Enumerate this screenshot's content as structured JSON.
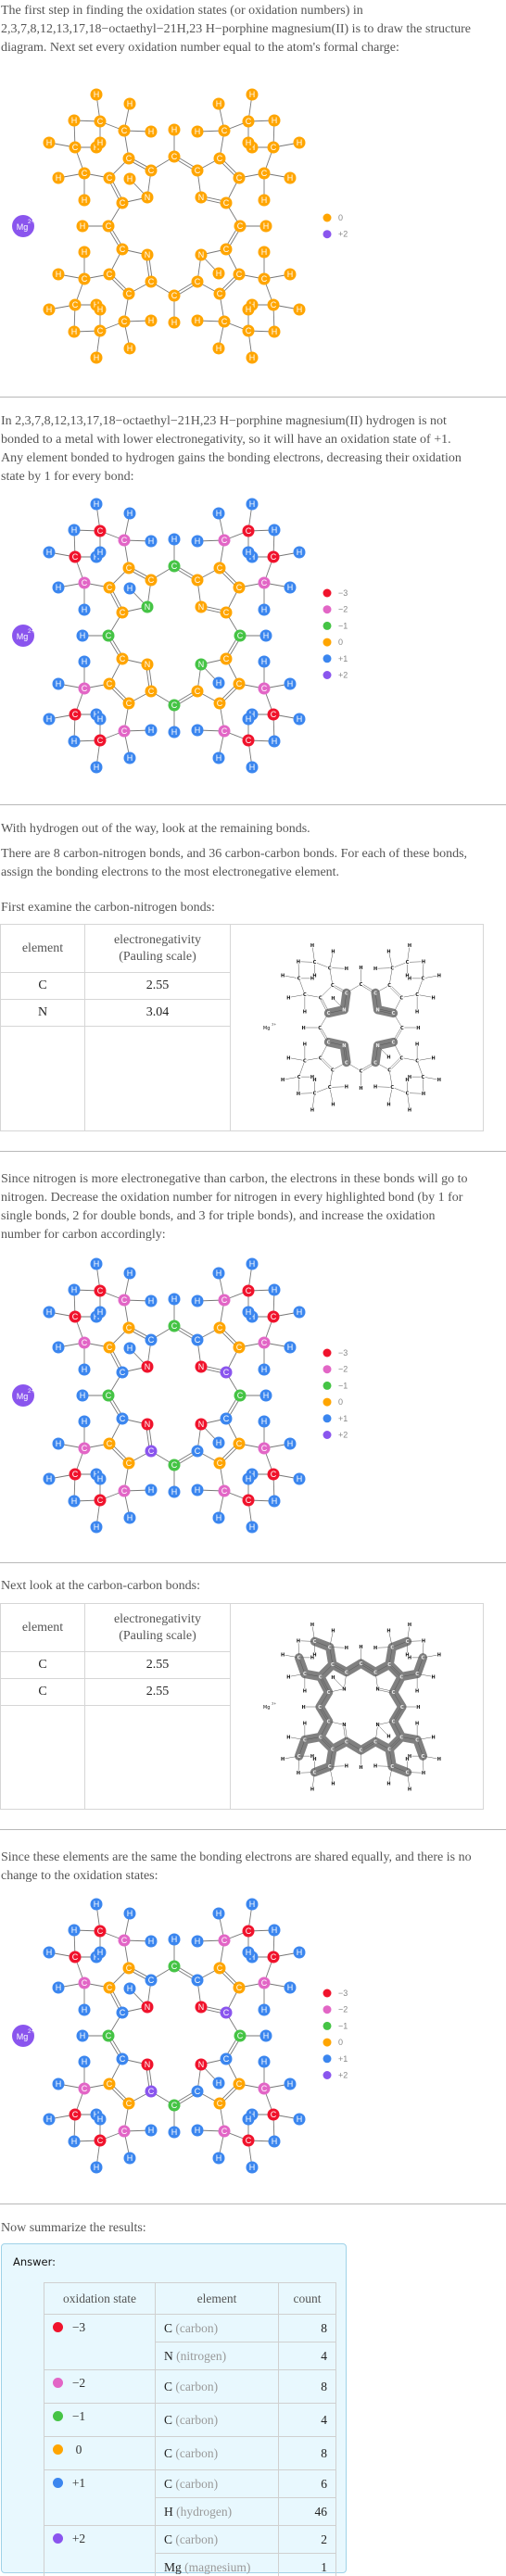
{
  "paragraphs": {
    "intro": "The first step in finding the oxidation states (or oxidation numbers) in 2,3,7,8,12,13,17,18−octaethyl−21H,23 H−porphine magnesium(II) is to draw the structure diagram. Next set every oxidation number equal to the atom's formal charge:",
    "hydrogen": "In 2,3,7,8,12,13,17,18−octaethyl−21H,23 H−porphine magnesium(II) hydrogen is not bonded to a metal with lower electronegativity, so it will have an oxidation state of +1. Any element bonded to hydrogen gains the bonding electrons, decreasing their oxidation state by 1 for every bond:",
    "remaining": "With hydrogen out of the way, look at the remaining bonds.",
    "bond_counts": "There are 8 carbon-nitrogen bonds, and 36 carbon-carbon bonds.  For each of these bonds, assign the bonding electrons to the most electronegative element.",
    "first_cn": "First examine the carbon-nitrogen bonds:",
    "nitrogen": "Since nitrogen is more electronegative than carbon, the electrons in these bonds will go to nitrogen. Decrease the oxidation number for nitrogen in every highlighted bond (by 1 for single bonds, 2 for double bonds, and 3 for triple bonds), and increase the oxidation number for carbon accordingly:",
    "next_cc": "Next look at the carbon-carbon bonds:",
    "same": "Since these elements are the same the bonding electrons are shared equally, and there is no change to the oxidation states:",
    "summarize": "Now summarize the results:"
  },
  "atom_labels": {
    "C": "C",
    "H": "H",
    "N": "N",
    "Mg": "Mg",
    "Mg_charge": "2+"
  },
  "colors": {
    "-3": "#f0132c",
    "-2": "#e266c6",
    "-1": "#45c445",
    "0": "#ffa500",
    "+1": "#3b86ef",
    "+2": "#8a55ee",
    "highlight": "#808080"
  },
  "legend_initial": [
    {
      "label": "0",
      "color": "#ffa500"
    },
    {
      "label": "+2",
      "color": "#8a55ee"
    }
  ],
  "legend_full": [
    {
      "label": "−3",
      "color": "#f0132c"
    },
    {
      "label": "−2",
      "color": "#e266c6"
    },
    {
      "label": "−1",
      "color": "#45c445"
    },
    {
      "label": "0",
      "color": "#ffa500"
    },
    {
      "label": "+1",
      "color": "#3b86ef"
    },
    {
      "label": "+2",
      "color": "#8a55ee"
    }
  ],
  "table_cn": {
    "header_element": "element",
    "header_en_1": "electronegativity",
    "header_en_2": "(Pauling scale)",
    "rows": [
      {
        "element": "C",
        "value": "2.55"
      },
      {
        "element": "N",
        "value": "3.04"
      }
    ]
  },
  "table_cc": {
    "header_element": "element",
    "header_en_1": "electronegativity",
    "header_en_2": "(Pauling scale)",
    "rows": [
      {
        "element": "C",
        "value": "2.55"
      },
      {
        "element": "C",
        "value": "2.55"
      }
    ]
  },
  "answer": {
    "label": "Answer:",
    "headers": [
      "oxidation state",
      "element",
      "count"
    ],
    "groups": [
      {
        "state": "−3",
        "color": "#f0132c",
        "rows": [
          {
            "symbol": "C",
            "name": "(carbon)",
            "count": "8"
          },
          {
            "symbol": "N",
            "name": "(nitrogen)",
            "count": "4"
          }
        ]
      },
      {
        "state": "−2",
        "color": "#e266c6",
        "rows": [
          {
            "symbol": "C",
            "name": "(carbon)",
            "count": "8"
          }
        ]
      },
      {
        "state": "−1",
        "color": "#45c445",
        "rows": [
          {
            "symbol": "C",
            "name": "(carbon)",
            "count": "4"
          }
        ]
      },
      {
        "state": "0",
        "color": "#ffa500",
        "rows": [
          {
            "symbol": "C",
            "name": "(carbon)",
            "count": "8"
          }
        ]
      },
      {
        "state": "+1",
        "color": "#3b86ef",
        "rows": [
          {
            "symbol": "C",
            "name": "(carbon)",
            "count": "6"
          },
          {
            "symbol": "H",
            "name": "(hydrogen)",
            "count": "46"
          }
        ]
      },
      {
        "state": "+2",
        "color": "#8a55ee",
        "rows": [
          {
            "symbol": "C",
            "name": "(carbon)",
            "count": "2"
          },
          {
            "symbol": "Mg",
            "name": "(magnesium)",
            "count": "1"
          }
        ]
      }
    ]
  }
}
